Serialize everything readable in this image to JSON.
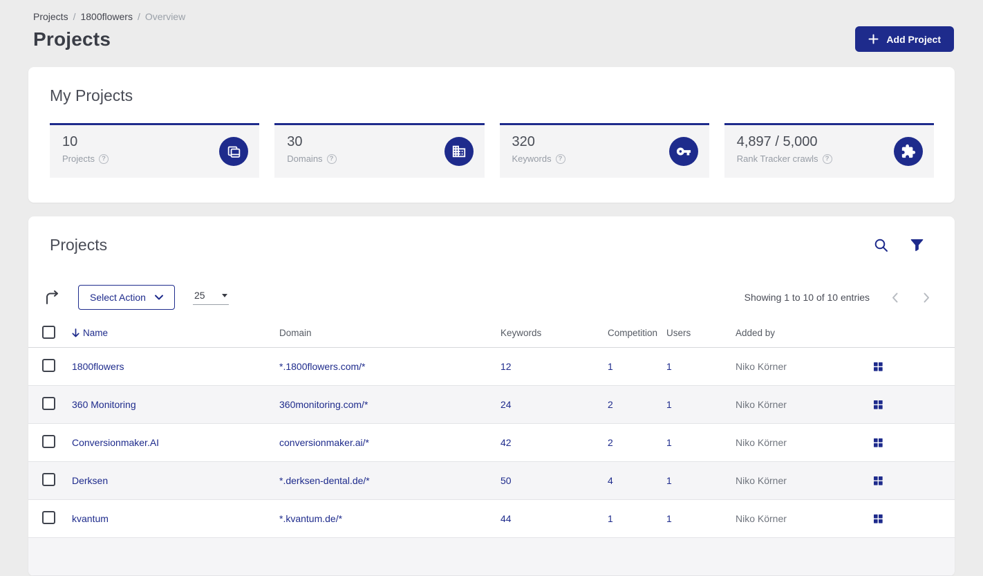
{
  "colors": {
    "brand_navy": "#1e2b8c",
    "page_background": "#ececec",
    "stat_tile_background": "#f4f4f5",
    "alt_row_background": "#f5f5f7"
  },
  "ui": {
    "help_glyph": "?"
  },
  "icons": {
    "add_project": "plus-icon",
    "stat_projects": "projects-stack-icon",
    "stat_domains": "building-icon",
    "stat_keywords": "key-icon",
    "stat_crawls": "puzzle-icon",
    "table_search": "search-icon",
    "table_filter": "filter-funnel-icon",
    "export": "forward-arrow-icon",
    "sort": "arrow-down-icon",
    "row_actions": "grid-icon",
    "pagination": [
      "chevron-left-icon",
      "chevron-right-icon"
    ],
    "help": "question-circle-icon"
  },
  "breadcrumb": {
    "item1": "Projects",
    "item2": "1800flowers",
    "item3": "Overview",
    "separator": "/"
  },
  "header": {
    "title": "Projects",
    "add_project_label": "Add Project"
  },
  "my_projects": {
    "title": "My Projects",
    "stats": [
      {
        "value": "10",
        "label": "Projects",
        "icon": "projects-stack-icon"
      },
      {
        "value": "30",
        "label": "Domains",
        "icon": "building-icon"
      },
      {
        "value": "320",
        "label": "Keywords",
        "icon": "key-icon"
      },
      {
        "value": "4,897 / 5,000",
        "label": "Rank Tracker crawls",
        "icon": "puzzle-icon"
      }
    ]
  },
  "projects_table": {
    "title": "Projects",
    "toolbar": {
      "select_action_label": "Select Action",
      "page_size_value": "25",
      "showing_text": "Showing 1 to 10 of 10 entries"
    },
    "columns": {
      "name": "Name",
      "domain": "Domain",
      "keywords": "Keywords",
      "competition": "Competition",
      "users": "Users",
      "added_by": "Added by"
    },
    "rows": [
      {
        "name": "1800flowers",
        "domain": "*.1800flowers.com/*",
        "keywords": "12",
        "competition": "1",
        "users": "1",
        "added_by": "Niko Körner"
      },
      {
        "name": "360 Monitoring",
        "domain": "360monitoring.com/*",
        "keywords": "24",
        "competition": "2",
        "users": "1",
        "added_by": "Niko Körner"
      },
      {
        "name": "Conversionmaker.AI",
        "domain": "conversionmaker.ai/*",
        "keywords": "42",
        "competition": "2",
        "users": "1",
        "added_by": "Niko Körner"
      },
      {
        "name": "Derksen",
        "domain": "*.derksen-dental.de/*",
        "keywords": "50",
        "competition": "4",
        "users": "1",
        "added_by": "Niko Körner"
      },
      {
        "name": "kvantum",
        "domain": "*.kvantum.de/*",
        "keywords": "44",
        "competition": "1",
        "users": "1",
        "added_by": "Niko Körner"
      }
    ]
  }
}
